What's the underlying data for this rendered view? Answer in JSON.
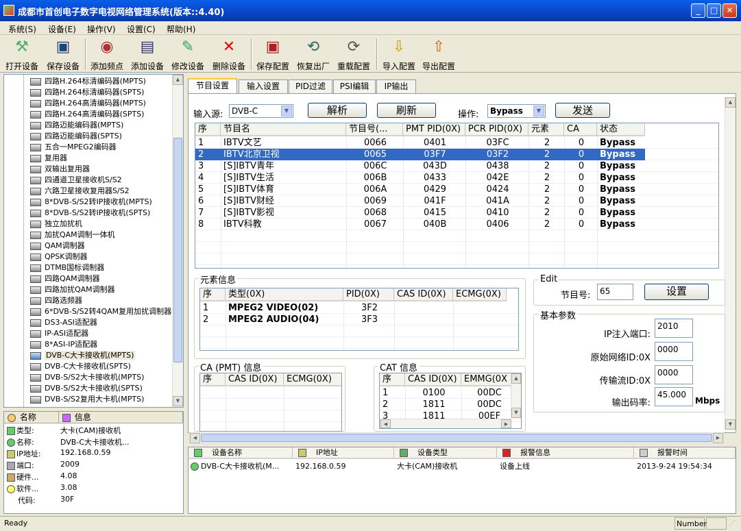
{
  "window": {
    "title": "成都市首创电子数字电视网络管理系统(版本::4.40)"
  },
  "menu": [
    "系统(S)",
    "设备(E)",
    "操作(V)",
    "设置(C)",
    "帮助(H)"
  ],
  "toolbar": [
    {
      "label": "打开设备",
      "icon": "open-device-icon"
    },
    {
      "label": "保存设备",
      "icon": "save-device-icon"
    },
    {
      "label": "添加频点",
      "icon": "add-frequency-icon"
    },
    {
      "label": "添加设备",
      "icon": "add-device-icon"
    },
    {
      "label": "修改设备",
      "icon": "edit-device-icon"
    },
    {
      "label": "删除设备",
      "icon": "delete-device-icon"
    },
    {
      "label": "保存配置",
      "icon": "save-config-icon"
    },
    {
      "label": "恢复出厂",
      "icon": "factory-reset-icon"
    },
    {
      "label": "重载配置",
      "icon": "reload-config-icon"
    },
    {
      "label": "导入配置",
      "icon": "import-config-icon"
    },
    {
      "label": "导出配置",
      "icon": "export-config-icon"
    }
  ],
  "tree": {
    "items": [
      "四路H.264标清编码器(MPTS)",
      "四路H.264标清编码器(SPTS)",
      "四路H.264高清编码器(MPTS)",
      "四路H.264高清编码器(SPTS)",
      "四路迈能编码器(MPTS)",
      "四路迈能编码器(SPTS)",
      "五合一MPEG2编码器",
      "复用器",
      "双输出复用器",
      "四通道卫星接收机S/S2",
      "六路卫星接收复用器S/S2",
      "8*DVB-S/S2转IP接收机(MPTS)",
      "8*DVB-S/S2转IP接收机(SPTS)",
      "独立加扰机",
      "加扰QAM调制一体机",
      "QAM调制器",
      "QPSK调制器",
      "DTMB国标调制器",
      "四路QAM调制器",
      "四路加扰QAM调制器",
      "四路选频器",
      "6*DVB-S/S2转4QAM复用加扰调制器",
      "DS3-ASI适配器",
      "IP-ASI适配器",
      "8*ASI-IP适配器",
      "DVB-C大卡接收机(MPTS)",
      "DVB-C大卡接收机(SPTS)",
      "DVB-S/S2大卡接收机(MPTS)",
      "DVB-S/S2大卡接收机(SPTS)",
      "DVB-S/S2复用大卡机(MPTS)"
    ],
    "selected_index": 25
  },
  "info_panel": {
    "headers": [
      "名称",
      "信息"
    ],
    "rows": [
      {
        "key": "类型:",
        "value": "大卡(CAM)接收机"
      },
      {
        "key": "名称:",
        "value": "DVB-C大卡接收机..."
      },
      {
        "key": "IP地址:",
        "value": "192.168.0.59"
      },
      {
        "key": "端口:",
        "value": "2009"
      },
      {
        "key": "硬件...",
        "value": "4.08"
      },
      {
        "key": "软件...",
        "value": "3.08"
      },
      {
        "key": "代码:",
        "value": "30F"
      }
    ]
  },
  "tabs": [
    "节目设置",
    "输入设置",
    "PID过滤",
    "PSI编辑",
    "IP输出"
  ],
  "program_tab": {
    "input_source_label": "输入源:",
    "input_source_value": "DVB-C",
    "parse_button": "解析",
    "refresh_button": "刷新",
    "operation_label": "操作:",
    "operation_value": "Bypass",
    "send_button": "发送",
    "program_table": {
      "headers": [
        "序",
        "节目名",
        "节目号(...",
        "PMT PID(0X)",
        "PCR PID(0X)",
        "元素",
        "CA",
        "状态"
      ],
      "rows": [
        [
          "1",
          "IBTV文艺",
          "0066",
          "0401",
          "03FC",
          "2",
          "0",
          "Bypass"
        ],
        [
          "2",
          "IBTV北京卫视",
          "0065",
          "03F7",
          "03F2",
          "2",
          "0",
          "Bypass"
        ],
        [
          "3",
          "[S]IBTV青年",
          "006C",
          "043D",
          "0438",
          "2",
          "0",
          "Bypass"
        ],
        [
          "4",
          "[S]IBTV生活",
          "006B",
          "0433",
          "042E",
          "2",
          "0",
          "Bypass"
        ],
        [
          "5",
          "[S]IBTV体育",
          "006A",
          "0429",
          "0424",
          "2",
          "0",
          "Bypass"
        ],
        [
          "6",
          "[S]IBTV财经",
          "0069",
          "041F",
          "041A",
          "2",
          "0",
          "Bypass"
        ],
        [
          "7",
          "[S]IBTV影视",
          "0068",
          "0415",
          "0410",
          "2",
          "0",
          "Bypass"
        ],
        [
          "8",
          "IBTV科教",
          "0067",
          "040B",
          "0406",
          "2",
          "0",
          "Bypass"
        ]
      ],
      "selected_index": 1
    },
    "element_group": {
      "title": "元素信息",
      "headers": [
        "序",
        "类型(0X)",
        "PID(0X)",
        "CAS ID(0X)",
        "ECMG(0X)"
      ],
      "rows": [
        [
          "1",
          "MPEG2 VIDEO(02)",
          "3F2"
        ],
        [
          "2",
          "MPEG2 AUDIO(04)",
          "3F3"
        ]
      ]
    },
    "edit_group": {
      "title": "Edit",
      "program_no_label": "节目号:",
      "program_no_value": "65",
      "set_button": "设置"
    },
    "basic_group": {
      "title": "基本参数",
      "fields": [
        {
          "label": "IP注入端口:",
          "value": "2010",
          "unit": ""
        },
        {
          "label": "原始网络ID:0X",
          "value": "0000",
          "unit": ""
        },
        {
          "label": "传输流ID:0X",
          "value": "0000",
          "unit": ""
        },
        {
          "label": "输出码率:",
          "value": "45.000",
          "unit": "Mbps"
        }
      ]
    },
    "ca_group": {
      "title": "CA (PMT) 信息",
      "headers": [
        "序",
        "CAS ID(0X)",
        "ECMG(0X)"
      ]
    },
    "cat_group": {
      "title": "CAT 信息",
      "headers": [
        "序",
        "CAS ID(0X)",
        "EMMG(0X"
      ],
      "rows": [
        [
          "1",
          "0100",
          "00DC"
        ],
        [
          "2",
          "1811",
          "00DC"
        ],
        [
          "3",
          "1811",
          "00EF"
        ]
      ]
    }
  },
  "alarm_list": {
    "headers": [
      "设备名称",
      "IP地址",
      "设备类型",
      "报警信息",
      "报警时间"
    ],
    "rows": [
      [
        "DVB-C大卡接收机(M...",
        "192.168.0.59",
        "大卡(CAM)接收机",
        "设备上线",
        "2013-9-24 19:54:34"
      ]
    ]
  },
  "status": {
    "left": "Ready",
    "right": "Number"
  }
}
